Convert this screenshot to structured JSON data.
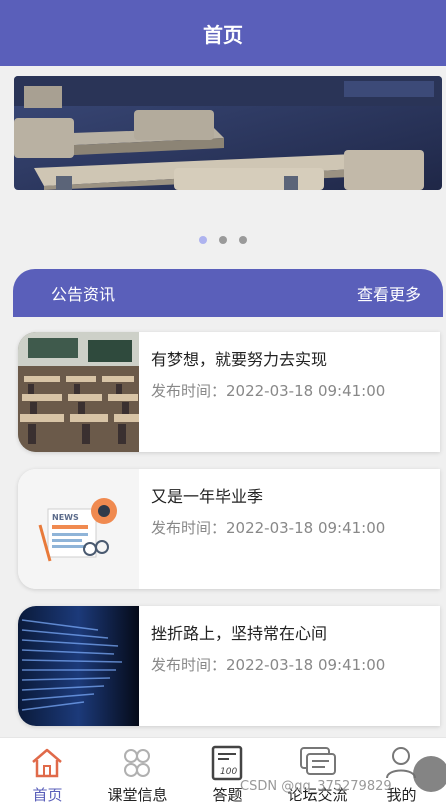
{
  "header": {
    "title": "首页"
  },
  "carousel": {
    "slide_count": 3,
    "active_index": 0
  },
  "notice": {
    "title": "公告资讯",
    "more_label": "查看更多"
  },
  "articles": [
    {
      "title": "有梦想，就要努力去实现",
      "meta": "发布时间：2022-03-18 09:41:00",
      "thumb": "classroom-photo"
    },
    {
      "title": "又是一年毕业季",
      "meta": "发布时间：2022-03-18 09:41:00",
      "thumb": "news-illustration"
    },
    {
      "title": "挫折路上，坚持常在心间",
      "meta": "发布时间：2022-03-18 09:41:00",
      "thumb": "code-screen-photo"
    }
  ],
  "tabbar": {
    "items": [
      {
        "label": "首页",
        "icon": "home-icon",
        "active": true
      },
      {
        "label": "课堂信息",
        "icon": "clover-icon",
        "active": false
      },
      {
        "label": "答题",
        "icon": "quiz-sheet-icon",
        "active": false
      },
      {
        "label": "论坛交流",
        "icon": "chat-bubble-icon",
        "active": false
      },
      {
        "label": "我的",
        "icon": "user-icon",
        "active": false
      }
    ]
  },
  "watermark": "CSDN @qq_375279829",
  "colors": {
    "brand": "#5a5fba",
    "active_dot": "#aeb3ef"
  }
}
